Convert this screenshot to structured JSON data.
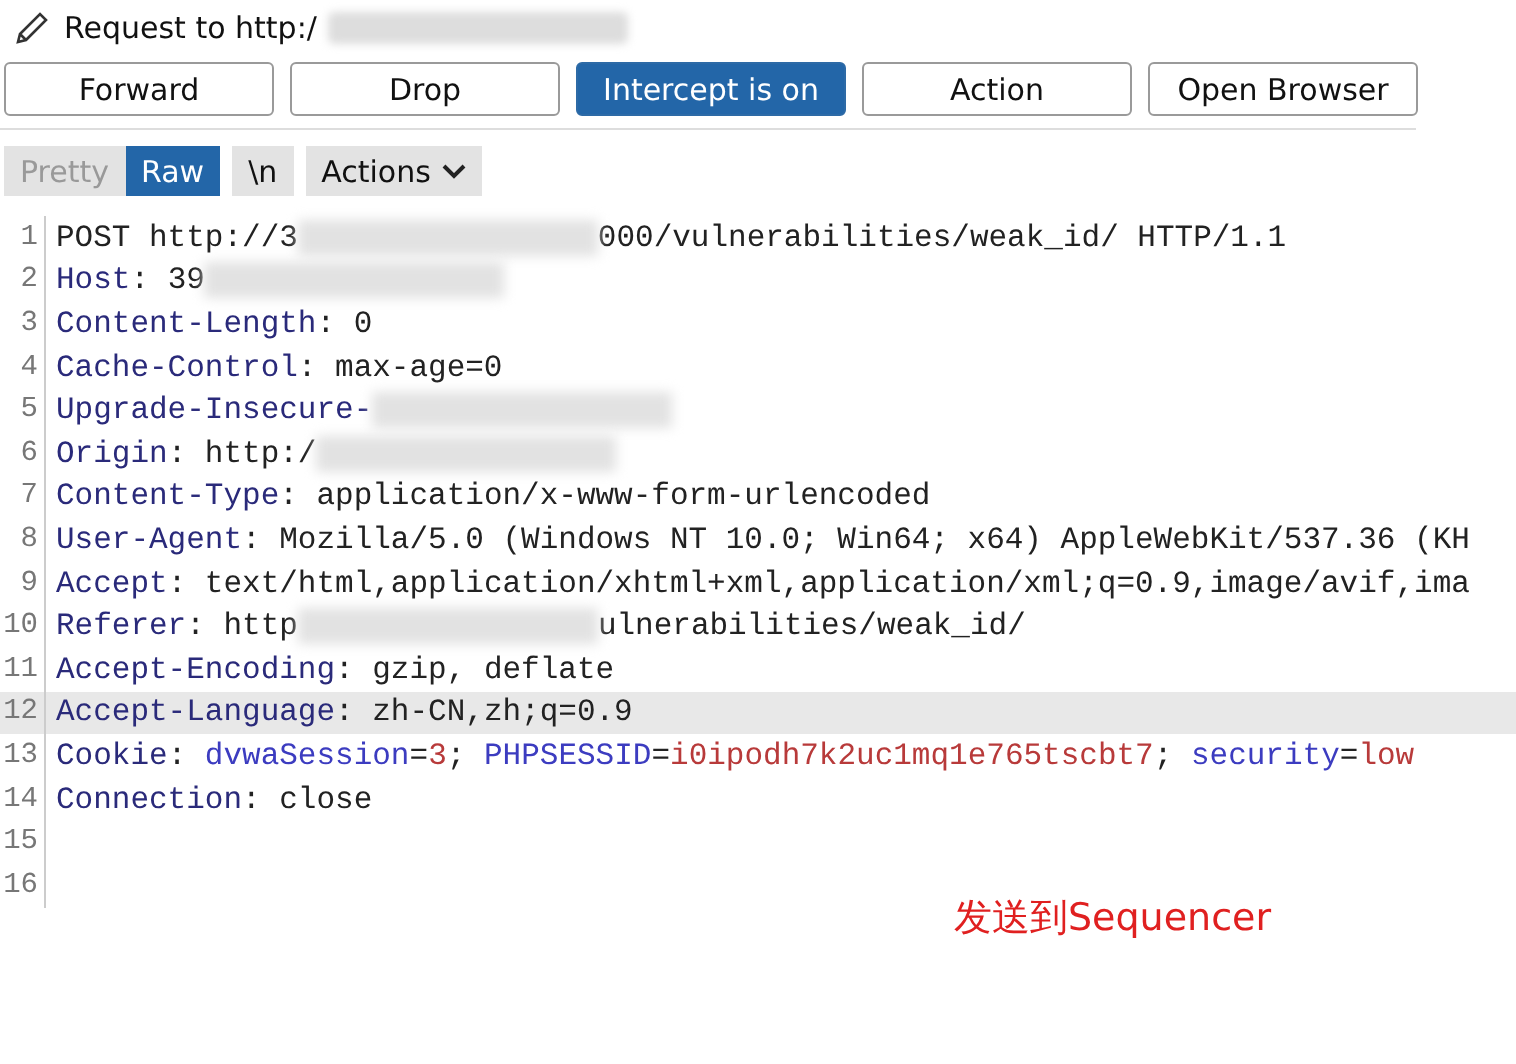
{
  "title": "Request to http:/",
  "buttons": [
    {
      "label": "Forward",
      "selected": false
    },
    {
      "label": "Drop",
      "selected": false
    },
    {
      "label": "Intercept is on",
      "selected": true
    },
    {
      "label": "Action",
      "selected": false
    },
    {
      "label": "Open Browser",
      "selected": false
    }
  ],
  "view_tabs": [
    {
      "label": "Pretty",
      "selected": false
    },
    {
      "label": "Raw",
      "selected": true
    }
  ],
  "newline_toggle": "\\n",
  "actions_menu": "Actions",
  "lines": [
    {
      "number": "1",
      "selected": false,
      "parts": [
        {
          "kind": "text",
          "text": "POST http://3"
        },
        {
          "kind": "redacted"
        },
        {
          "kind": "text",
          "text": "000/vulnerabilities/weak_id/ HTTP/1.1"
        }
      ]
    },
    {
      "number": "2",
      "selected": false,
      "parts": [
        {
          "kind": "name",
          "text": "Host"
        },
        {
          "kind": "text",
          "text": ": 39"
        },
        {
          "kind": "redacted"
        }
      ]
    },
    {
      "number": "3",
      "selected": false,
      "parts": [
        {
          "kind": "name",
          "text": "Content-Length"
        },
        {
          "kind": "text",
          "text": ": 0"
        }
      ]
    },
    {
      "number": "4",
      "selected": false,
      "parts": [
        {
          "kind": "name",
          "text": "Cache-Control"
        },
        {
          "kind": "text",
          "text": ": max-age=0"
        }
      ]
    },
    {
      "number": "5",
      "selected": false,
      "parts": [
        {
          "kind": "name",
          "text": "Upgrade-Insecure-"
        },
        {
          "kind": "redacted"
        }
      ]
    },
    {
      "number": "6",
      "selected": false,
      "parts": [
        {
          "kind": "name",
          "text": "Origin"
        },
        {
          "kind": "text",
          "text": ": http:/"
        },
        {
          "kind": "redacted"
        }
      ]
    },
    {
      "number": "7",
      "selected": false,
      "parts": [
        {
          "kind": "name",
          "text": "Content-Type"
        },
        {
          "kind": "text",
          "text": ": application/x-www-form-urlencoded"
        }
      ]
    },
    {
      "number": "8",
      "selected": false,
      "parts": [
        {
          "kind": "name",
          "text": "User-Agent"
        },
        {
          "kind": "text",
          "text": ": Mozilla/5.0 (Windows NT 10.0; Win64; x64) AppleWebKit/537.36 (KH"
        }
      ]
    },
    {
      "number": "9",
      "selected": false,
      "parts": [
        {
          "kind": "name",
          "text": "Accept"
        },
        {
          "kind": "text",
          "text": ": text/html,application/xhtml+xml,application/xml;q=0.9,image/avif,ima"
        }
      ]
    },
    {
      "number": "10",
      "selected": false,
      "parts": [
        {
          "kind": "name",
          "text": "Referer"
        },
        {
          "kind": "text",
          "text": ": http"
        },
        {
          "kind": "redacted"
        },
        {
          "kind": "text",
          "text": "ulnerabilities/weak_id/"
        }
      ]
    },
    {
      "number": "11",
      "selected": false,
      "parts": [
        {
          "kind": "name",
          "text": "Accept-Encoding"
        },
        {
          "kind": "text",
          "text": ": gzip, deflate"
        }
      ]
    },
    {
      "number": "12",
      "selected": true,
      "parts": [
        {
          "kind": "name",
          "text": "Accept-Language"
        },
        {
          "kind": "text",
          "text": ": zh-CN,zh;q=0.9"
        }
      ]
    },
    {
      "number": "13",
      "selected": false,
      "parts": [
        {
          "kind": "name",
          "text": "Cookie"
        },
        {
          "kind": "text",
          "text": ": "
        },
        {
          "kind": "param",
          "text": "dvwaSession"
        },
        {
          "kind": "text",
          "text": "="
        },
        {
          "kind": "param-value",
          "text": "3"
        },
        {
          "kind": "text",
          "text": "; "
        },
        {
          "kind": "param",
          "text": "PHPSESSID"
        },
        {
          "kind": "text",
          "text": "="
        },
        {
          "kind": "param-value",
          "text": "i0ipodh7k2uc1mq1e765tscbt7"
        },
        {
          "kind": "text",
          "text": "; "
        },
        {
          "kind": "param",
          "text": "security"
        },
        {
          "kind": "text",
          "text": "="
        },
        {
          "kind": "param-value",
          "text": "low"
        }
      ]
    },
    {
      "number": "14",
      "selected": false,
      "parts": [
        {
          "kind": "name",
          "text": "Connection"
        },
        {
          "kind": "text",
          "text": ": close"
        }
      ]
    },
    {
      "number": "15",
      "selected": false
    },
    {
      "number": "16",
      "selected": false
    }
  ],
  "annotation": "发送到Sequencer"
}
